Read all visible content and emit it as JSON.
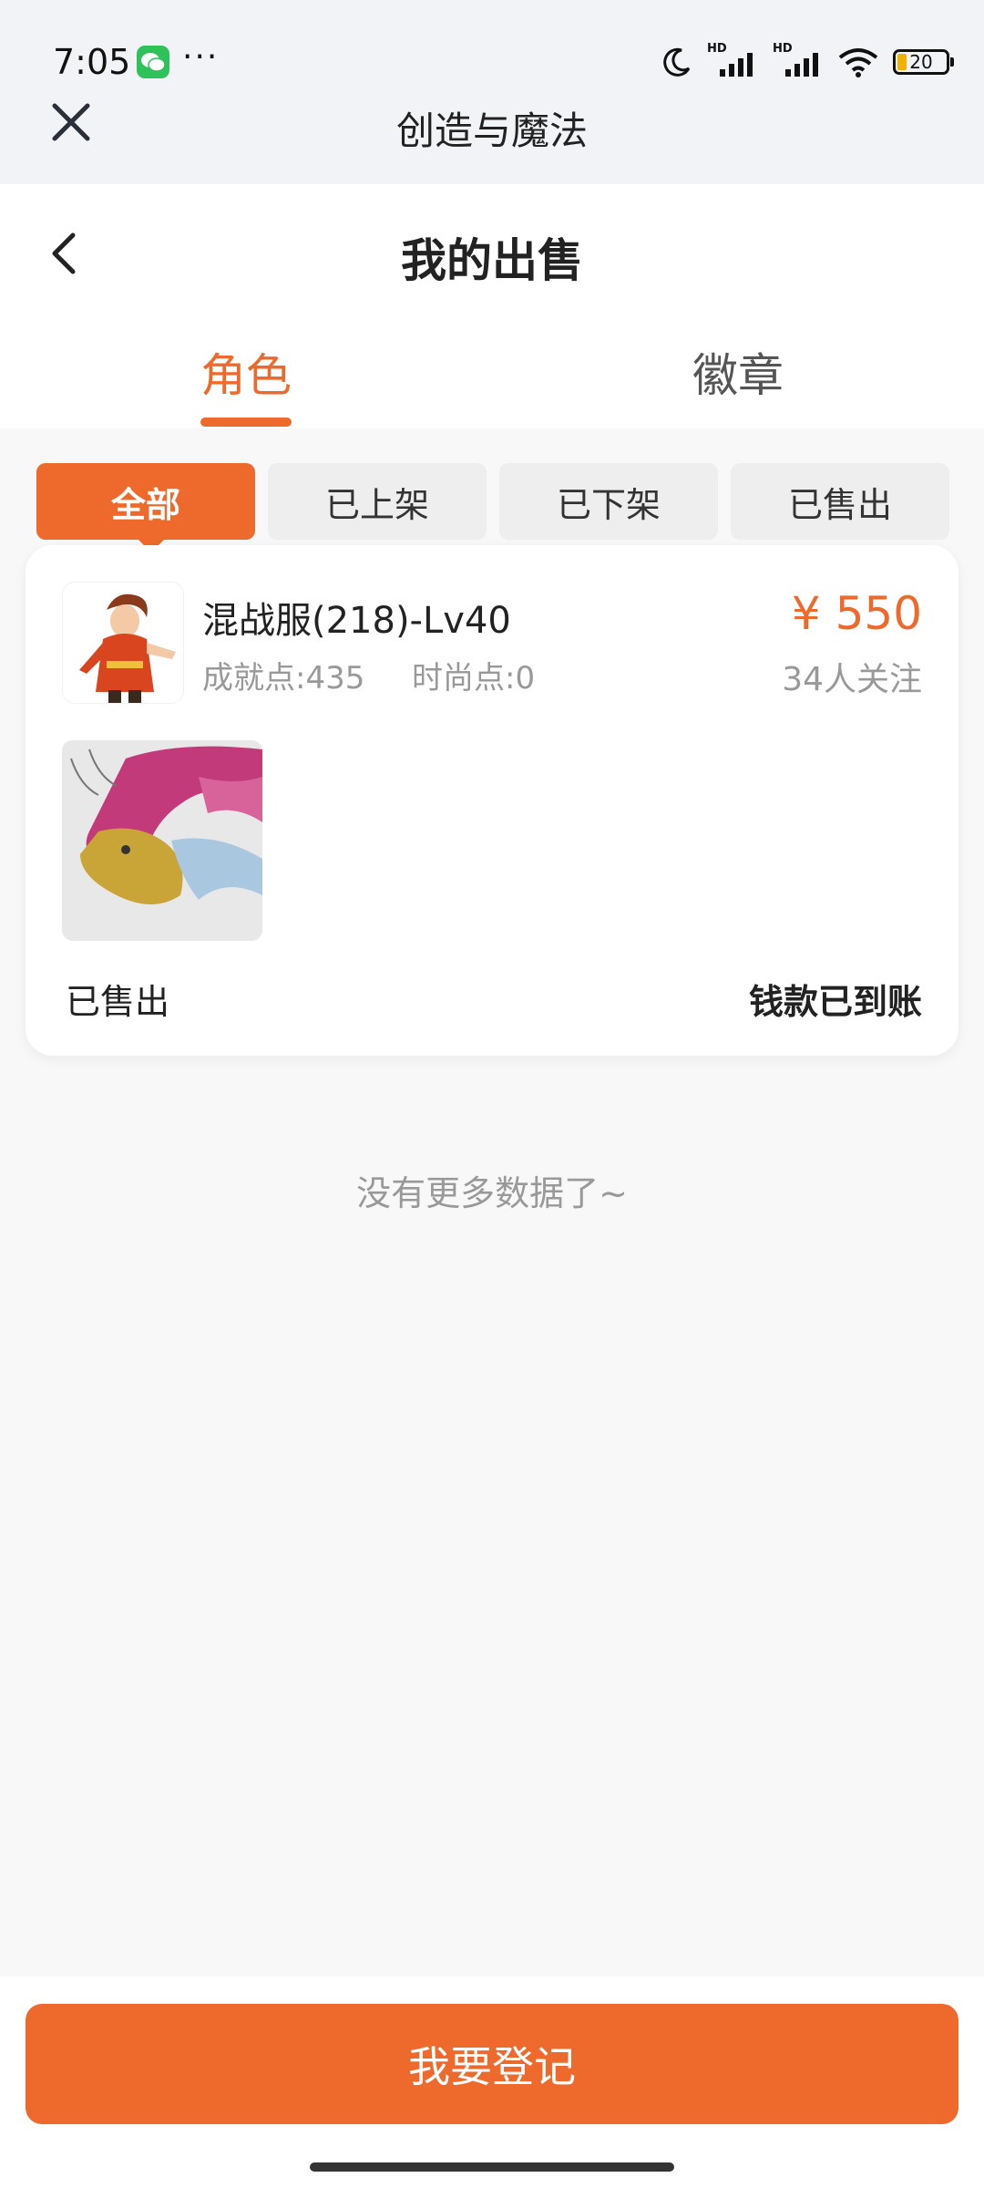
{
  "status_bar": {
    "time": "7:05",
    "app_icon": "wechat-icon",
    "more": "···",
    "battery": "20"
  },
  "miniprogram": {
    "title": "创造与魔法",
    "close_icon": "close-icon"
  },
  "header": {
    "title": "我的出售",
    "back_icon": "chevron-left-icon"
  },
  "tabs": [
    {
      "label": "角色",
      "active": true
    },
    {
      "label": "徽章",
      "active": false
    }
  ],
  "filters": [
    {
      "label": "全部",
      "active": true
    },
    {
      "label": "已上架",
      "active": false
    },
    {
      "label": "已下架",
      "active": false
    },
    {
      "label": "已售出",
      "active": false
    }
  ],
  "listing": {
    "name": "混战服(218)-Lv40",
    "achievement": "成就点:435",
    "fashion": "时尚点:0",
    "price": "¥ 550",
    "followers": "34人关注",
    "status": "已售出",
    "payment": "钱款已到账"
  },
  "list_end": "没有更多数据了~",
  "register_button": "我要登记",
  "colors": {
    "accent": "#ee6a2c",
    "background": "#f8f8f8",
    "top_bar": "#f1f3f6",
    "filter_inactive": "#eeeeee"
  }
}
